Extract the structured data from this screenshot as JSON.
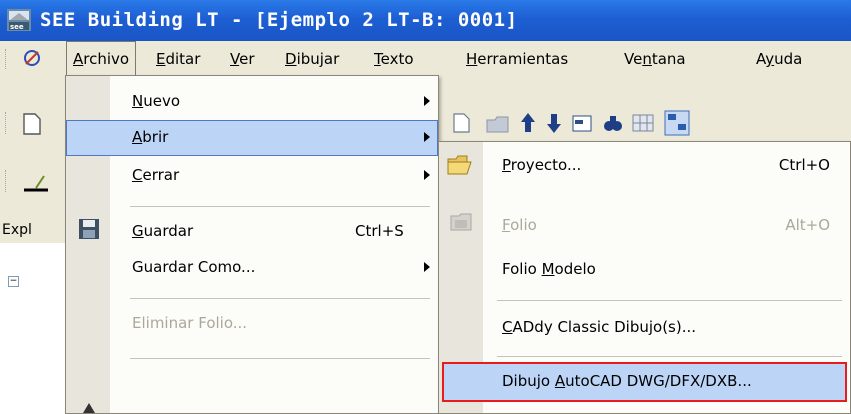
{
  "window": {
    "title": "SEE Building LT - [Ejemplo 2 LT-B: 0001]"
  },
  "menubar": {
    "items": [
      {
        "pre": "",
        "u": "A",
        "post": "rchivo"
      },
      {
        "pre": "",
        "u": "E",
        "post": "ditar"
      },
      {
        "pre": "",
        "u": "V",
        "post": "er"
      },
      {
        "pre": "",
        "u": "D",
        "post": "ibujar"
      },
      {
        "pre": "",
        "u": "T",
        "post": "exto"
      },
      {
        "pre": "",
        "u": "H",
        "post": "erramientas"
      },
      {
        "pre": "Ve",
        "u": "n",
        "post": "tana"
      },
      {
        "pre": "A",
        "u": "y",
        "post": "uda"
      }
    ]
  },
  "explorer": {
    "label": "Expl"
  },
  "archivo_menu": {
    "nuevo": {
      "pre": "",
      "u": "N",
      "post": "uevo"
    },
    "abrir": {
      "pre": "",
      "u": "A",
      "post": "brir"
    },
    "cerrar": {
      "pre": "",
      "u": "C",
      "post": "errar"
    },
    "guardar": {
      "pre": "",
      "u": "G",
      "post": "uardar",
      "shortcut": "Ctrl+S"
    },
    "guardar_como": {
      "label": "Guardar Como..."
    },
    "eliminar_folio": {
      "label": "Eliminar Folio..."
    }
  },
  "abrir_submenu": {
    "proyecto": {
      "pre": "",
      "u": "P",
      "post": "royecto...",
      "shortcut": "Ctrl+O"
    },
    "folio": {
      "pre": "",
      "u": "F",
      "post": "olio",
      "shortcut": "Alt+O"
    },
    "folio_modelo": {
      "pre": "Folio ",
      "u": "M",
      "post": "odelo"
    },
    "caddy": {
      "pre": "",
      "u": "C",
      "post": "ADdy Classic Dibujo(s)..."
    },
    "autocad": {
      "pre": "Dibujo ",
      "u": "A",
      "post": "utoCAD DWG/DFX/DXB..."
    }
  },
  "colors": {
    "title_bar": "#1d5fd3",
    "highlight": "#bcd4f6",
    "focus_border": "#e81c1c"
  }
}
